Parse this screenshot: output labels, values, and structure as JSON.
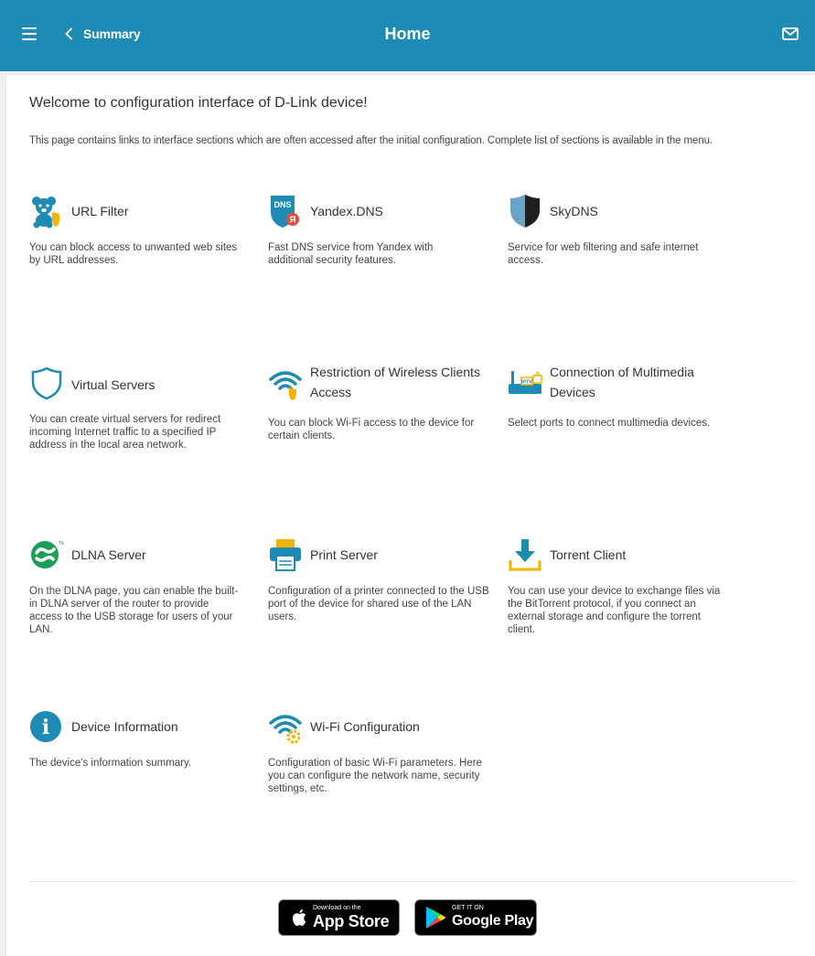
{
  "header": {
    "back_label": "Summary",
    "title": "Home"
  },
  "main": {
    "welcome": "Welcome to configuration interface of D-Link device!",
    "intro": "This page contains links to interface sections which are often accessed after the initial configuration. Complete list of sections is available in the menu.",
    "tiles": [
      {
        "title": "URL Filter",
        "desc": "You can block access to unwanted web sites by URL addresses.",
        "icon": "url-filter-icon"
      },
      {
        "title": "Yandex.DNS",
        "desc": "Fast DNS service from Yandex with additional security features.",
        "icon": "yandex-dns-icon",
        "icon_text": "DNS"
      },
      {
        "title": "SkyDNS",
        "desc": "Service for web filtering and safe internet access.",
        "icon": "skydns-shield-icon"
      },
      {
        "title": "Virtual Servers",
        "desc": "You can create virtual servers for redirect incoming Internet traffic to a specified IP address in the local area network.",
        "icon": "shield-outline-icon"
      },
      {
        "title": "Restriction of Wireless Clients Access",
        "desc": "You can block Wi-Fi access to the device for certain clients.",
        "icon": "wifi-shield-icon"
      },
      {
        "title": "Connection of Multimedia Devices",
        "desc": "Select ports to connect multimedia devices.",
        "icon": "multimedia-icon",
        "icon_text": "IPTV"
      },
      {
        "title": "DLNA Server",
        "desc": "On the DLNA page, you can enable the built-in DLNA server of the router to provide access to the USB storage for users of your LAN.",
        "icon": "dlna-icon"
      },
      {
        "title": "Print Server",
        "desc": "Configuration of a printer connected to the USB port of the device for shared use of the LAN users.",
        "icon": "printer-icon"
      },
      {
        "title": "Torrent Client",
        "desc": "You can use your device to exchange files via the BitTorrent protocol, if you connect an external storage and configure the torrent client.",
        "icon": "download-icon"
      },
      {
        "title": "Device Information",
        "desc": "The device's information summary.",
        "icon": "info-icon",
        "icon_text": "i"
      },
      {
        "title": "Wi-Fi Configuration",
        "desc": "Configuration of basic Wi-Fi parameters. Here you can configure the network name, security settings, etc.",
        "icon": "wifi-gear-icon"
      }
    ]
  },
  "stores": {
    "appstore_small": "Download on the",
    "appstore_big": "App Store",
    "googleplay_small": "GET IT ON",
    "googleplay_big": "Google Play"
  },
  "colors": {
    "header": "#1d8bb3",
    "icon_blue": "#1d8bb3",
    "icon_orange": "#f5b301"
  }
}
